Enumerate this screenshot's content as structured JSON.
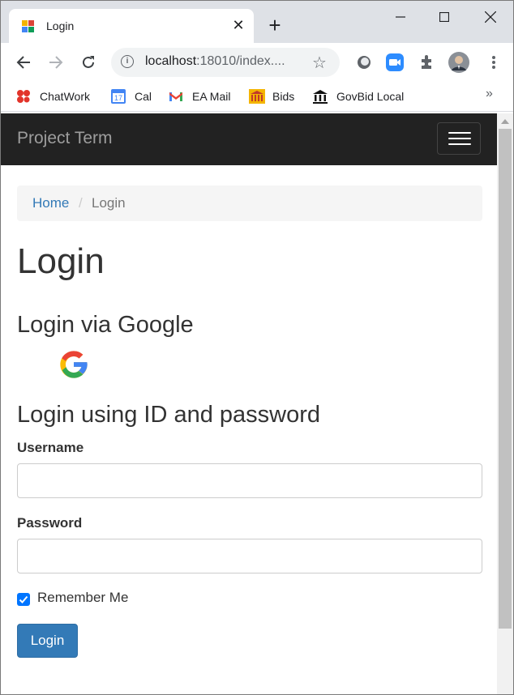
{
  "browser": {
    "tab_title": "Login",
    "url_host": "localhost",
    "url_rest": ":18010/index....",
    "bookmarks": [
      {
        "label": "ChatWork",
        "icon": "chatwork-icon"
      },
      {
        "label": "Cal",
        "icon": "calendar-icon",
        "badge": "17"
      },
      {
        "label": "EA Mail",
        "icon": "gmail-icon"
      },
      {
        "label": "Bids",
        "icon": "bids-icon"
      },
      {
        "label": "GovBid Local",
        "icon": "govbid-icon"
      }
    ],
    "bookmarks_more": "»"
  },
  "navbar": {
    "brand": "Project Term"
  },
  "breadcrumb": {
    "home": "Home",
    "separator": "/",
    "current": "Login"
  },
  "page": {
    "title": "Login",
    "google_heading": "Login via Google",
    "id_heading": "Login using ID and password",
    "username_label": "Username",
    "username_value": "",
    "password_label": "Password",
    "password_value": "",
    "remember_label": "Remember Me",
    "remember_checked": true,
    "login_button": "Login"
  },
  "colors": {
    "navbar_bg": "#222222",
    "link": "#337ab7",
    "button": "#337ab7",
    "checkbox": "#0075ff"
  }
}
